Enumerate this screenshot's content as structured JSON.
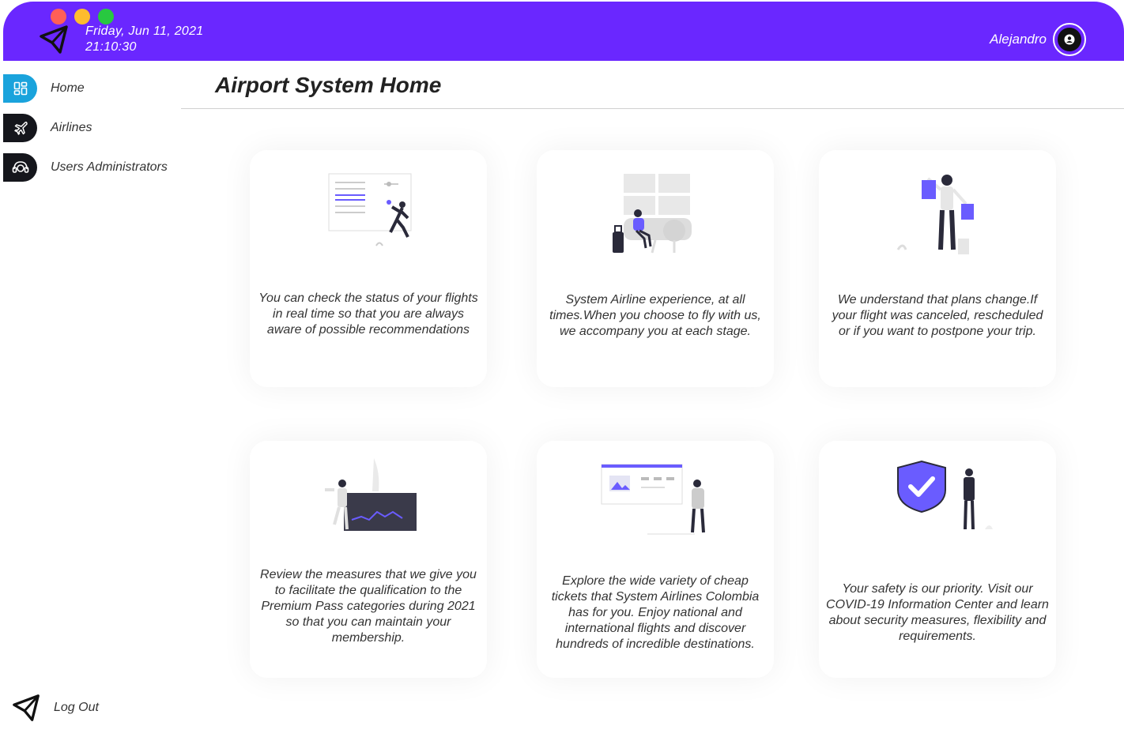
{
  "header": {
    "date": "Friday, Jun 11, 2021",
    "time": "21:10:30",
    "user_name": "Alejandro",
    "bg_color": "#6a27ff"
  },
  "sidebar": {
    "items": [
      {
        "label": "Home",
        "icon": "dashboard-icon",
        "active": true
      },
      {
        "label": "Airlines",
        "icon": "airplane-icon",
        "active": false
      },
      {
        "label": "Users Administrators",
        "icon": "headset-icon",
        "active": false
      }
    ],
    "logout_label": "Log Out",
    "active_color": "#1aa3dc"
  },
  "main": {
    "title": "Airport System Home",
    "cards": [
      {
        "text": "You can check the status of your flights in real time so that you are always aware of possible recommendations",
        "illustration": "flight-status-illustration"
      },
      {
        "text": "System Airline experience, at all times.When you choose to fly with us, we accompany you at each stage.",
        "illustration": "airport-waiting-illustration"
      },
      {
        "text": "We understand that plans change.If your flight was canceled, rescheduled or if you want to postpone your trip.",
        "illustration": "shopping-bags-illustration"
      },
      {
        "text": "Review the measures that we give you to facilitate the qualification to the Premium Pass categories during 2021 so that you can maintain your membership.",
        "illustration": "analytics-chart-illustration"
      },
      {
        "text": "Explore the wide variety of cheap tickets that System Airlines Colombia has for you. Enjoy national and international flights and discover hundreds of incredible destinations.",
        "illustration": "website-browse-illustration"
      },
      {
        "text": "Your safety is our priority. Visit our COVID-19 Information Center and learn about security measures, flexibility and requirements.",
        "illustration": "security-shield-illustration"
      }
    ]
  }
}
